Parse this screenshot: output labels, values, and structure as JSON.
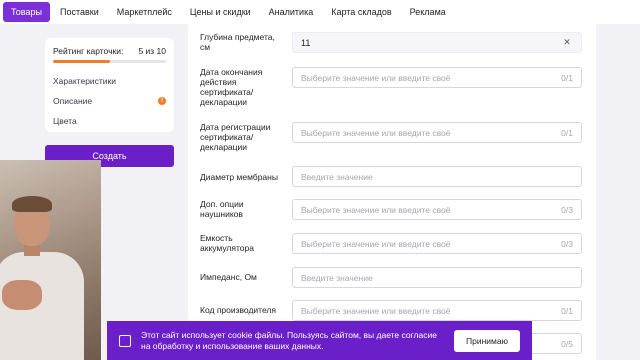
{
  "topnav": {
    "tabs": [
      "Товары",
      "Поставки",
      "Маркетплейс",
      "Цены и скидки",
      "Аналитика",
      "Карта складов",
      "Реклама"
    ]
  },
  "card": {
    "rating_label": "Рейтинг карточки:",
    "rating_value": "5 из 10",
    "rating_progress": 0.5,
    "links": [
      {
        "label": "Характеристики",
        "badge": ""
      },
      {
        "label": "Описание",
        "badge": "!"
      },
      {
        "label": "Цвета",
        "badge": ""
      }
    ]
  },
  "create_button": "Создать",
  "form": {
    "fields": [
      {
        "label": "Глубина предмета, см",
        "value": "11",
        "placeholder": "",
        "count": ""
      },
      {
        "label": "Дата окончания действия сертификата/декларации",
        "value": "",
        "placeholder": "Выберите значение или введите своё",
        "count": "0/1"
      },
      {
        "label": "Дата регистрации сертификата/декларации",
        "value": "",
        "placeholder": "Выберите значение или введите своё",
        "count": "0/1"
      },
      {
        "label": "Диаметр мембраны",
        "value": "",
        "placeholder": "Введите значение",
        "count": ""
      },
      {
        "label": "Доп. опции наушников",
        "value": "",
        "placeholder": "Выберите значение или введите своё",
        "count": "0/3"
      },
      {
        "label": "Емкость аккумулятора",
        "value": "",
        "placeholder": "Выберите значение или введите своё",
        "count": "0/3"
      },
      {
        "label": "Импеданс, Ом",
        "value": "",
        "placeholder": "Введите значение",
        "count": ""
      },
      {
        "label": "Код производителя",
        "value": "",
        "placeholder": "Выберите значение или введите своё",
        "count": "0/1"
      },
      {
        "label": "",
        "value": "",
        "placeholder": "",
        "count": "0/5"
      }
    ]
  },
  "cookie": {
    "text": "Этот сайт использует cookie файлы. Пользуясь сайтом, вы даете согласие на обработку и использование ваших данных.",
    "accept": "Принимаю"
  },
  "colors": {
    "accent": "#6a1fc9",
    "warning": "#f07c2c"
  }
}
